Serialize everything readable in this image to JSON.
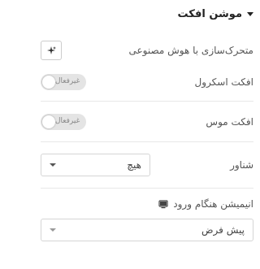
{
  "section": {
    "title": "موشن افکت",
    "caret_icon": "caret-down-icon"
  },
  "rows": {
    "ai_motion": {
      "label": "متحرک‌سازی با هوش مصنوعی",
      "icon": "sparkle-icon"
    },
    "scroll_effect": {
      "label": "افکت اسکرول",
      "toggle_text": "غیرفعال",
      "enabled": false
    },
    "mouse_effect": {
      "label": "افکت موس",
      "toggle_text": "غیرفعال",
      "enabled": false
    },
    "sticky": {
      "label": "شناور",
      "value": "هیچ"
    },
    "entrance_animation": {
      "label": "انیمیشن هنگام ورود",
      "device_icon": "desktop-icon",
      "value": "پیش فرض"
    }
  }
}
